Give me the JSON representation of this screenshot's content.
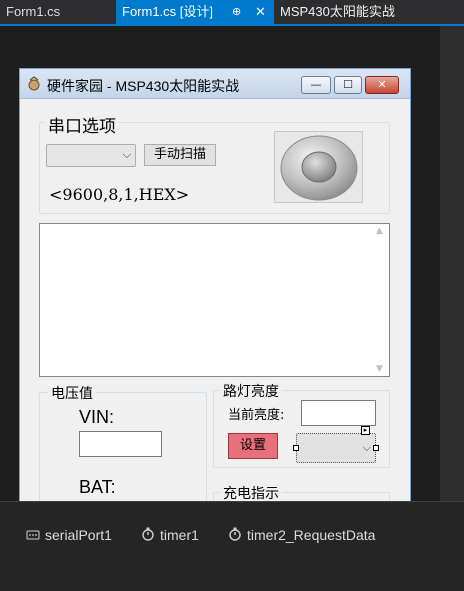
{
  "tabs": {
    "tab1": "Form1.cs",
    "tab2": "Form1.cs [设计]",
    "tab2_pin": "⊕",
    "tab2_close": "✕",
    "tab3": "MSP430太阳能实战"
  },
  "form": {
    "title": "硬件家园 - MSP430太阳能实战",
    "min_btn": "—",
    "max_btn": "☐",
    "close_btn": "✕"
  },
  "serial_group": {
    "title": "串口选项",
    "port_value": "",
    "scan_button": "手动扫描",
    "settings_text": "<9600,8,1,HEX>"
  },
  "voltage_group": {
    "title": "电压值",
    "vin_label": "VIN:",
    "vin_value": "",
    "bat_label": "BAT:",
    "bat_value": ""
  },
  "lamp_group": {
    "title": "路灯亮度",
    "current_label": "当前亮度:",
    "current_value": "",
    "set_button": "设置",
    "brightness_value": ""
  },
  "charge_group": {
    "title": "充电指示",
    "value": ""
  },
  "tray": {
    "items": [
      "serialPort1",
      "timer1",
      "timer2_RequestData"
    ],
    "icons": [
      "serial-port-icon",
      "stopwatch-icon",
      "stopwatch-icon"
    ]
  },
  "colors": {
    "tab_active": "#007acc",
    "set_button": "#e8707a",
    "led_ring": "#9e9e9e"
  }
}
